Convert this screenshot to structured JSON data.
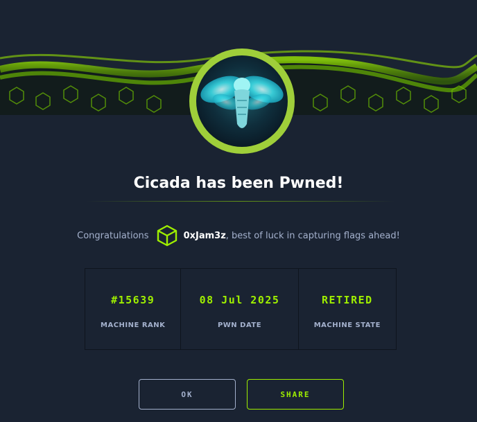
{
  "dialog": {
    "title": "Cicada has been Pwned!",
    "congrats_prefix": "Congratulations",
    "username": "0xJam3z",
    "congrats_suffix": ", best of luck in capturing flags ahead!"
  },
  "stats": [
    {
      "value": "#15639",
      "label": "MACHINE RANK"
    },
    {
      "value": "08 Jul 2025",
      "label": "PWN DATE"
    },
    {
      "value": "RETIRED",
      "label": "MACHINE STATE"
    }
  ],
  "buttons": {
    "ok_label": "OK",
    "share_label": "SHARE"
  },
  "colors": {
    "background": "#1a2332",
    "accent": "#9fef00",
    "muted_text": "#a4b1cd",
    "ring": "#9fcf3a"
  },
  "icons": {
    "banner": "green-hex-wave-banner",
    "avatar": "cicada-machine-avatar",
    "user_badge": "cube-icon"
  }
}
